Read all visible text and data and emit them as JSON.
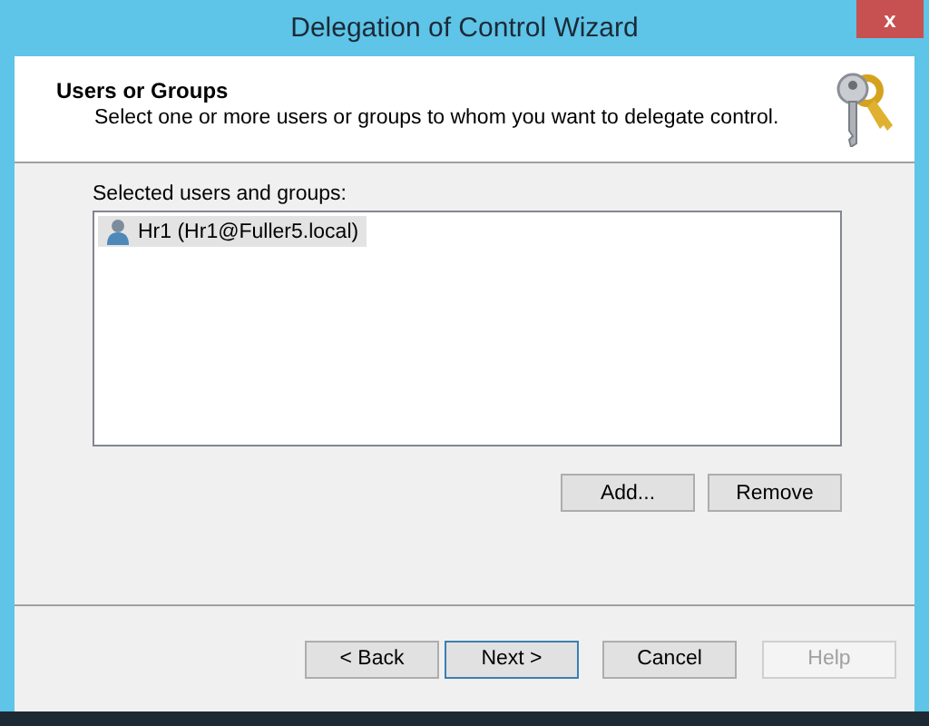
{
  "window": {
    "title": "Delegation of Control Wizard",
    "close": "x"
  },
  "header": {
    "title": "Users or Groups",
    "subtitle": "Select one or more users or groups to whom you want to delegate control."
  },
  "list": {
    "label": "Selected users and groups:",
    "items": [
      {
        "text": "Hr1 (Hr1@Fuller5.local)",
        "selected": true
      }
    ]
  },
  "list_buttons": [
    {
      "label": "Add...",
      "disabled": false,
      "default": false
    },
    {
      "label": "Remove",
      "disabled": false,
      "default": false
    }
  ],
  "footer_buttons": [
    {
      "label": "< Back",
      "disabled": false,
      "default": false
    },
    {
      "label": "Next >",
      "disabled": false,
      "default": true
    },
    {
      "label": "Cancel",
      "disabled": false,
      "default": false
    },
    {
      "label": "Help",
      "disabled": true,
      "default": false
    }
  ]
}
